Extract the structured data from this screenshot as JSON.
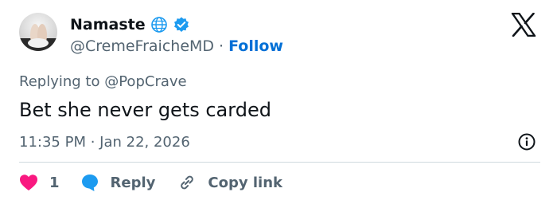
{
  "author": {
    "display_name": "Namaste",
    "handle": "@CremeFraicheMD",
    "separator": "·",
    "follow_label": "Follow"
  },
  "tweet": {
    "replying_prefix": "Replying to",
    "replying_to": "@PopCrave",
    "text": "Bet she never gets carded",
    "timestamp": "11:35 PM · Jan 22, 2026"
  },
  "actions": {
    "like_count": "1",
    "reply_label": "Reply",
    "copy_link_label": "Copy link"
  },
  "icons": {
    "globe": "globe-icon",
    "verified": "verified-badge-icon",
    "x_logo": "x-logo-icon",
    "info": "info-icon",
    "heart": "heart-icon",
    "reply": "reply-bubble-icon",
    "link": "link-icon"
  },
  "colors": {
    "like": "#f91880",
    "accent": "#1d9bf0",
    "follow": "#006fd6",
    "secondary_text": "#536471"
  }
}
